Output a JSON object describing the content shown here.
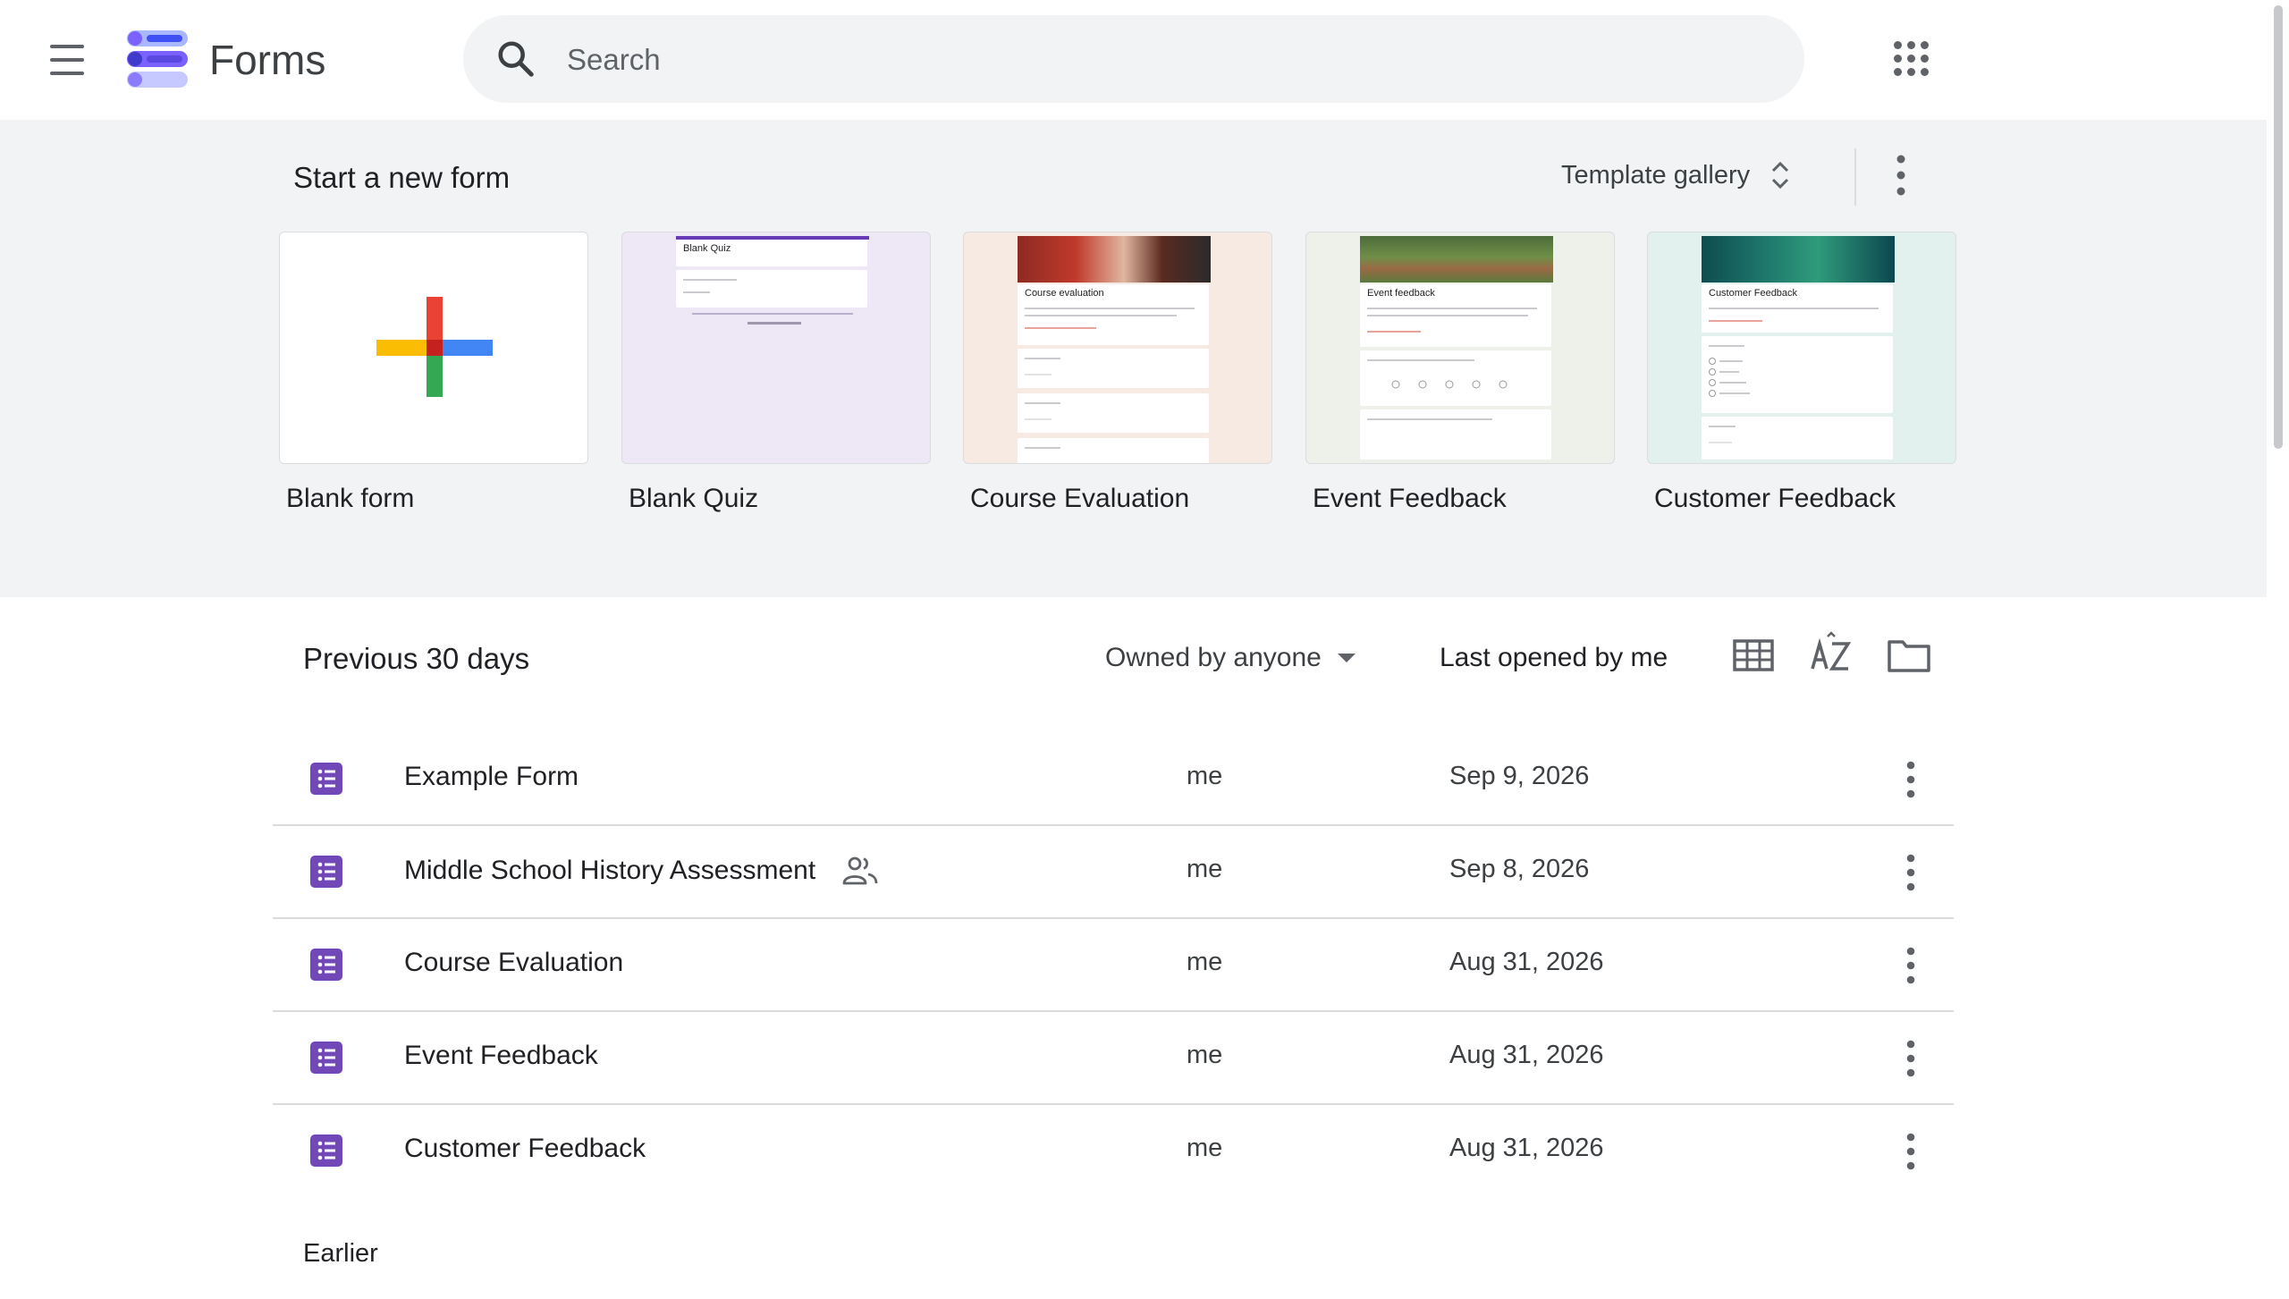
{
  "header": {
    "app_title": "Forms",
    "search_placeholder": "Search",
    "menu_icon": "hamburger-menu-icon",
    "apps_icon": "google-apps-grid-icon"
  },
  "templates": {
    "heading": "Start a new form",
    "gallery_label": "Template gallery",
    "items": [
      {
        "label": "Blank form"
      },
      {
        "label": "Blank Quiz",
        "preview_title": "Blank Quiz"
      },
      {
        "label": "Course Evaluation",
        "preview_title": "Course evaluation"
      },
      {
        "label": "Event Feedback",
        "preview_title": "Event feedback"
      },
      {
        "label": "Customer Feedback",
        "preview_title": "Customer Feedback"
      }
    ]
  },
  "recent": {
    "heading": "Previous 30 days",
    "owner_filter": "Owned by anyone",
    "sort_label": "Last opened by me",
    "earlier_heading": "Earlier",
    "files": [
      {
        "name": "Example Form",
        "owner": "me",
        "date": "Sep 9, 2026",
        "shared": false
      },
      {
        "name": "Middle School History Assessment",
        "owner": "me",
        "date": "Sep 8, 2026",
        "shared": true
      },
      {
        "name": "Course Evaluation",
        "owner": "me",
        "date": "Aug 31, 2026",
        "shared": false
      },
      {
        "name": "Event Feedback",
        "owner": "me",
        "date": "Aug 31, 2026",
        "shared": false
      },
      {
        "name": "Customer Feedback",
        "owner": "me",
        "date": "Aug 31, 2026",
        "shared": false
      }
    ]
  },
  "colors": {
    "forms_purple": "#673ab7",
    "file_icon": "#7248b9",
    "section_bg": "#f1f3f4"
  }
}
